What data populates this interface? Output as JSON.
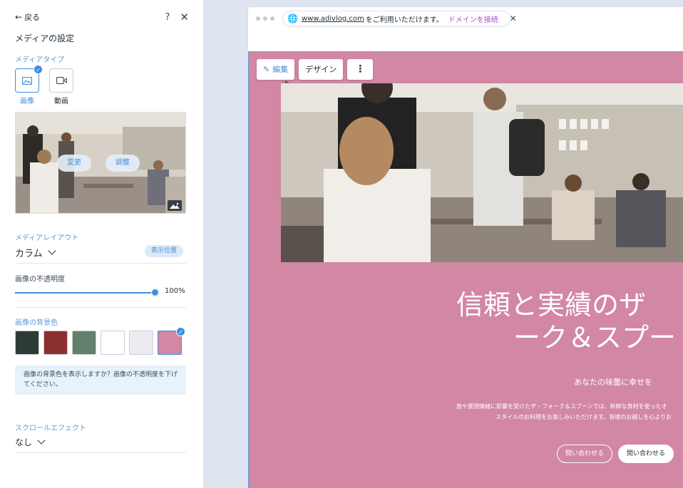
{
  "panel": {
    "back_label": "戻る",
    "help_label": "?",
    "close_label": "✕",
    "title": "メディアの設定",
    "media_type_label": "メディアタイプ",
    "media_types": [
      {
        "label": "画像",
        "selected": true,
        "icon": "image-icon"
      },
      {
        "label": "動画",
        "selected": false,
        "icon": "video-icon"
      }
    ],
    "thumb_buttons": {
      "change": "変更",
      "adjust": "調整"
    },
    "layout_label": "メディアレイアウト",
    "layout_value": "カラム",
    "position_button": "表示位置",
    "opacity_label": "画像の不透明度",
    "opacity_value": "100%",
    "opacity_fraction": 1.0,
    "bg_color_label": "画像の背景色",
    "swatches": [
      {
        "color": "#2e3b35",
        "selected": false
      },
      {
        "color": "#8c2f2f",
        "selected": false
      },
      {
        "color": "#63806c",
        "selected": false
      },
      {
        "color": "#ffffff",
        "selected": false
      },
      {
        "color": "#ececf0",
        "selected": false
      },
      {
        "color": "#d287a4",
        "selected": true
      }
    ],
    "info_text": "画像の背景色を表示しますか？画像の不透明度を下げてください。",
    "scroll_label": "スクロールエフェクト",
    "scroll_value": "なし"
  },
  "browser": {
    "url": "www.adivlog.com",
    "url_suffix": "をご利用いただけます。",
    "connect_link": "ドメインを接続"
  },
  "toolbar": {
    "edit_label": "編集",
    "design_label": "デザイン",
    "more_label": "⋮"
  },
  "site": {
    "headline_1": "信頼と実績のザ",
    "headline_2": "ーク＆スプー",
    "subheading": "あなたの味蕾に幸せを",
    "body_1": "旅や異国情緒に影響を受けたザ・フォーク＆スプーンでは、新鮮な食材を使ったオ",
    "body_2": "スタイルのお料理をお楽しみいただけます。皆様のお越しを心よりお",
    "cta_outline": "問い合わせる",
    "cta_solid": "問い合わせる",
    "bg_color": "#d287a4"
  }
}
